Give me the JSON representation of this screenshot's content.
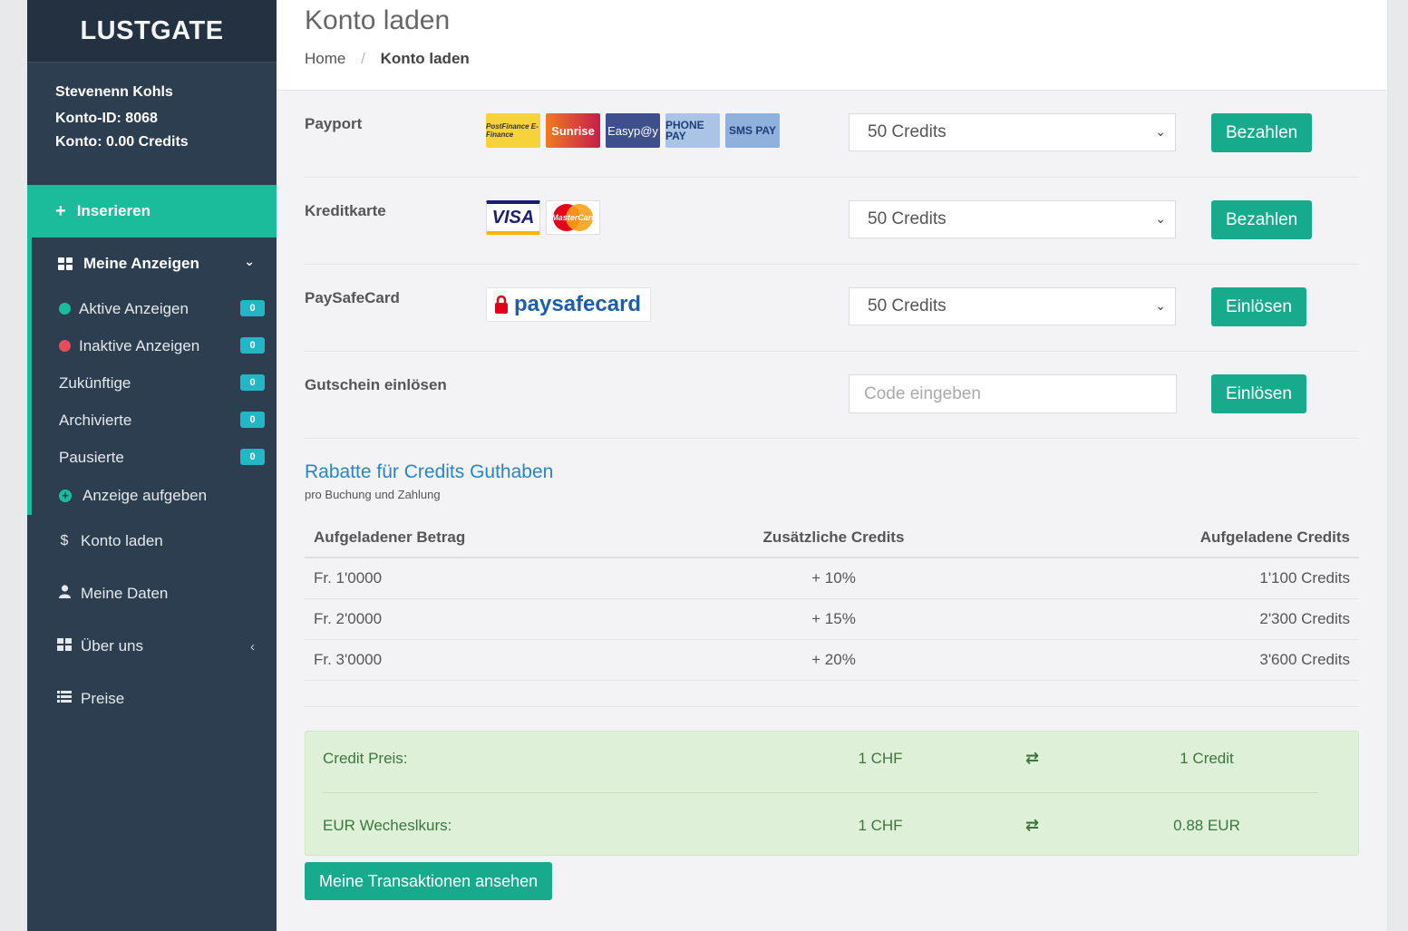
{
  "brand": "LUSTGATE",
  "user": {
    "name": "Stevenenn Kohls",
    "account_id": "Konto-ID: 8068",
    "balance": "Konto: 0.00 Credits"
  },
  "sidebar": {
    "insert": "Inserieren",
    "my_ads": "Meine Anzeigen",
    "sub_items": [
      {
        "label": "Aktive Anzeigen",
        "count": "0",
        "dot_color": "#1abc9c"
      },
      {
        "label": "Inaktive Anzeigen",
        "count": "0",
        "dot_color": "#e74c5c"
      },
      {
        "label": "Zukünftige",
        "count": "0"
      },
      {
        "label": "Archivierte",
        "count": "0"
      },
      {
        "label": "Pausierte",
        "count": "0"
      },
      {
        "label": "Anzeige aufgeben"
      }
    ],
    "items": [
      {
        "label": "Konto laden",
        "icon": "dollar-icon"
      },
      {
        "label": "Meine Daten",
        "icon": "user-icon"
      },
      {
        "label": "Über uns",
        "icon": "grid-icon"
      },
      {
        "label": "Preise",
        "icon": "list-icon"
      }
    ]
  },
  "header": {
    "title": "Konto laden",
    "breadcrumb": {
      "home": "Home",
      "sep": "/",
      "current": "Konto laden"
    }
  },
  "payments": [
    {
      "label": "Payport",
      "select": "50 Credits",
      "button": "Bezahlen",
      "logos": [
        "PostFinance E-Finance",
        "Sunrise",
        "Easyp@y",
        "PHONE PAY",
        "SMS PAY"
      ]
    },
    {
      "label": "Kreditkarte",
      "select": "50 Credits",
      "button": "Bezahlen",
      "logos": [
        "VISA",
        "MasterCard"
      ]
    },
    {
      "label": "PaySafeCard",
      "select": "50 Credits",
      "button": "Einlösen",
      "logos": [
        "paysafecard"
      ]
    },
    {
      "label": "Gutschein einlösen",
      "placeholder": "Code eingeben",
      "button": "Einlösen"
    }
  ],
  "discount": {
    "title": "Rabatte für Credits Guthaben",
    "subtitle": "pro Buchung und Zahlung",
    "headers": [
      "Aufgeladener Betrag",
      "Zusätzliche Credits",
      "Aufgeladene Credits"
    ],
    "rows": [
      [
        "Fr. 1'0000",
        "+ 10%",
        "1'100 Credits"
      ],
      [
        "Fr. 2'0000",
        "+ 15%",
        "2'300 Credits"
      ],
      [
        "Fr. 3'0000",
        "+ 20%",
        "3'600 Credits"
      ]
    ]
  },
  "rates": [
    {
      "label": "Credit Preis:",
      "from": "1 CHF",
      "to": "1 Credit"
    },
    {
      "label": "EUR Wecheslkurs:",
      "from": "1 CHF",
      "to": "0.88 EUR"
    }
  ],
  "transactions_button": "Meine Transaktionen ansehen",
  "colors": {
    "accent": "#1abc9c",
    "sidebar": "#2c3e50",
    "link": "#2a85c2",
    "success_bg": "#dff0d8"
  }
}
